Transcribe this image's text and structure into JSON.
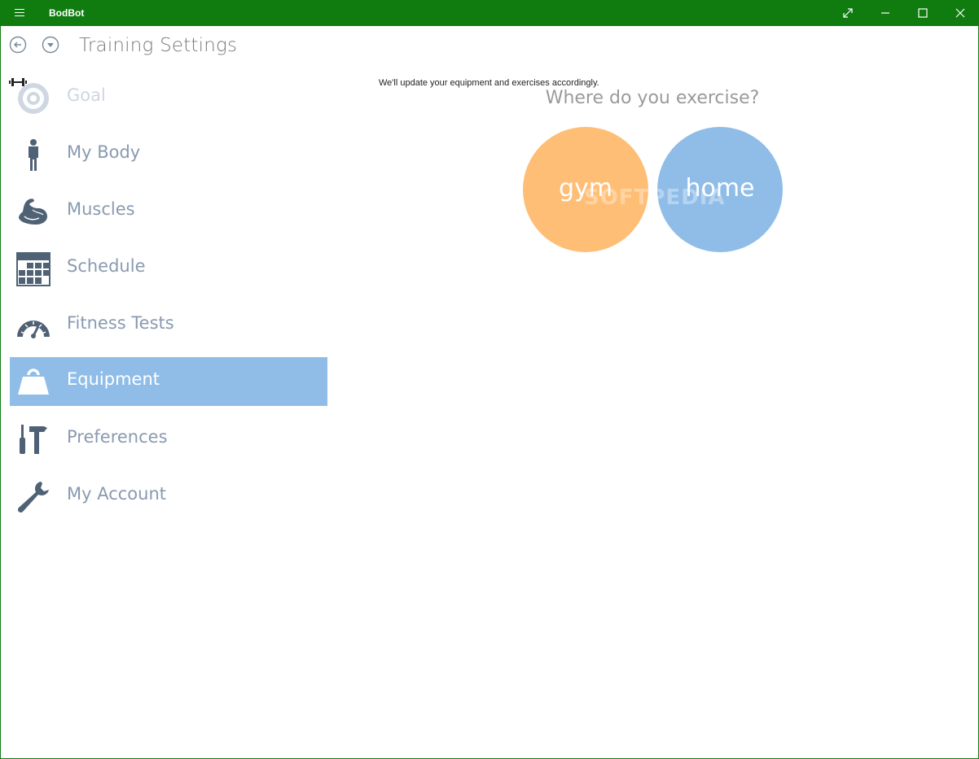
{
  "app": {
    "title": "BodBot",
    "accent_color": "#107c10"
  },
  "header": {
    "title": "Training Settings"
  },
  "sidebar": {
    "items": [
      {
        "label": "Goal",
        "icon": "target-icon",
        "state": "faded"
      },
      {
        "label": "My Body",
        "icon": "person-icon"
      },
      {
        "label": "Muscles",
        "icon": "flexed-arm-icon"
      },
      {
        "label": "Schedule",
        "icon": "calendar-grid-icon"
      },
      {
        "label": "Fitness Tests",
        "icon": "speedometer-icon"
      },
      {
        "label": "Equipment",
        "icon": "weight-icon",
        "state": "selected"
      },
      {
        "label": "Preferences",
        "icon": "tools-icon"
      },
      {
        "label": "My Account",
        "icon": "wrench-icon"
      }
    ],
    "active_color": "#8fbde8"
  },
  "main": {
    "hint": "We'll update your equipment and exercises accordingly.",
    "question": "Where do you exercise?",
    "choices": [
      {
        "label": "gym",
        "color": "#ffbe76"
      },
      {
        "label": "home",
        "color": "#8fbde8"
      }
    ]
  },
  "watermark": "SOFTPEDIA"
}
